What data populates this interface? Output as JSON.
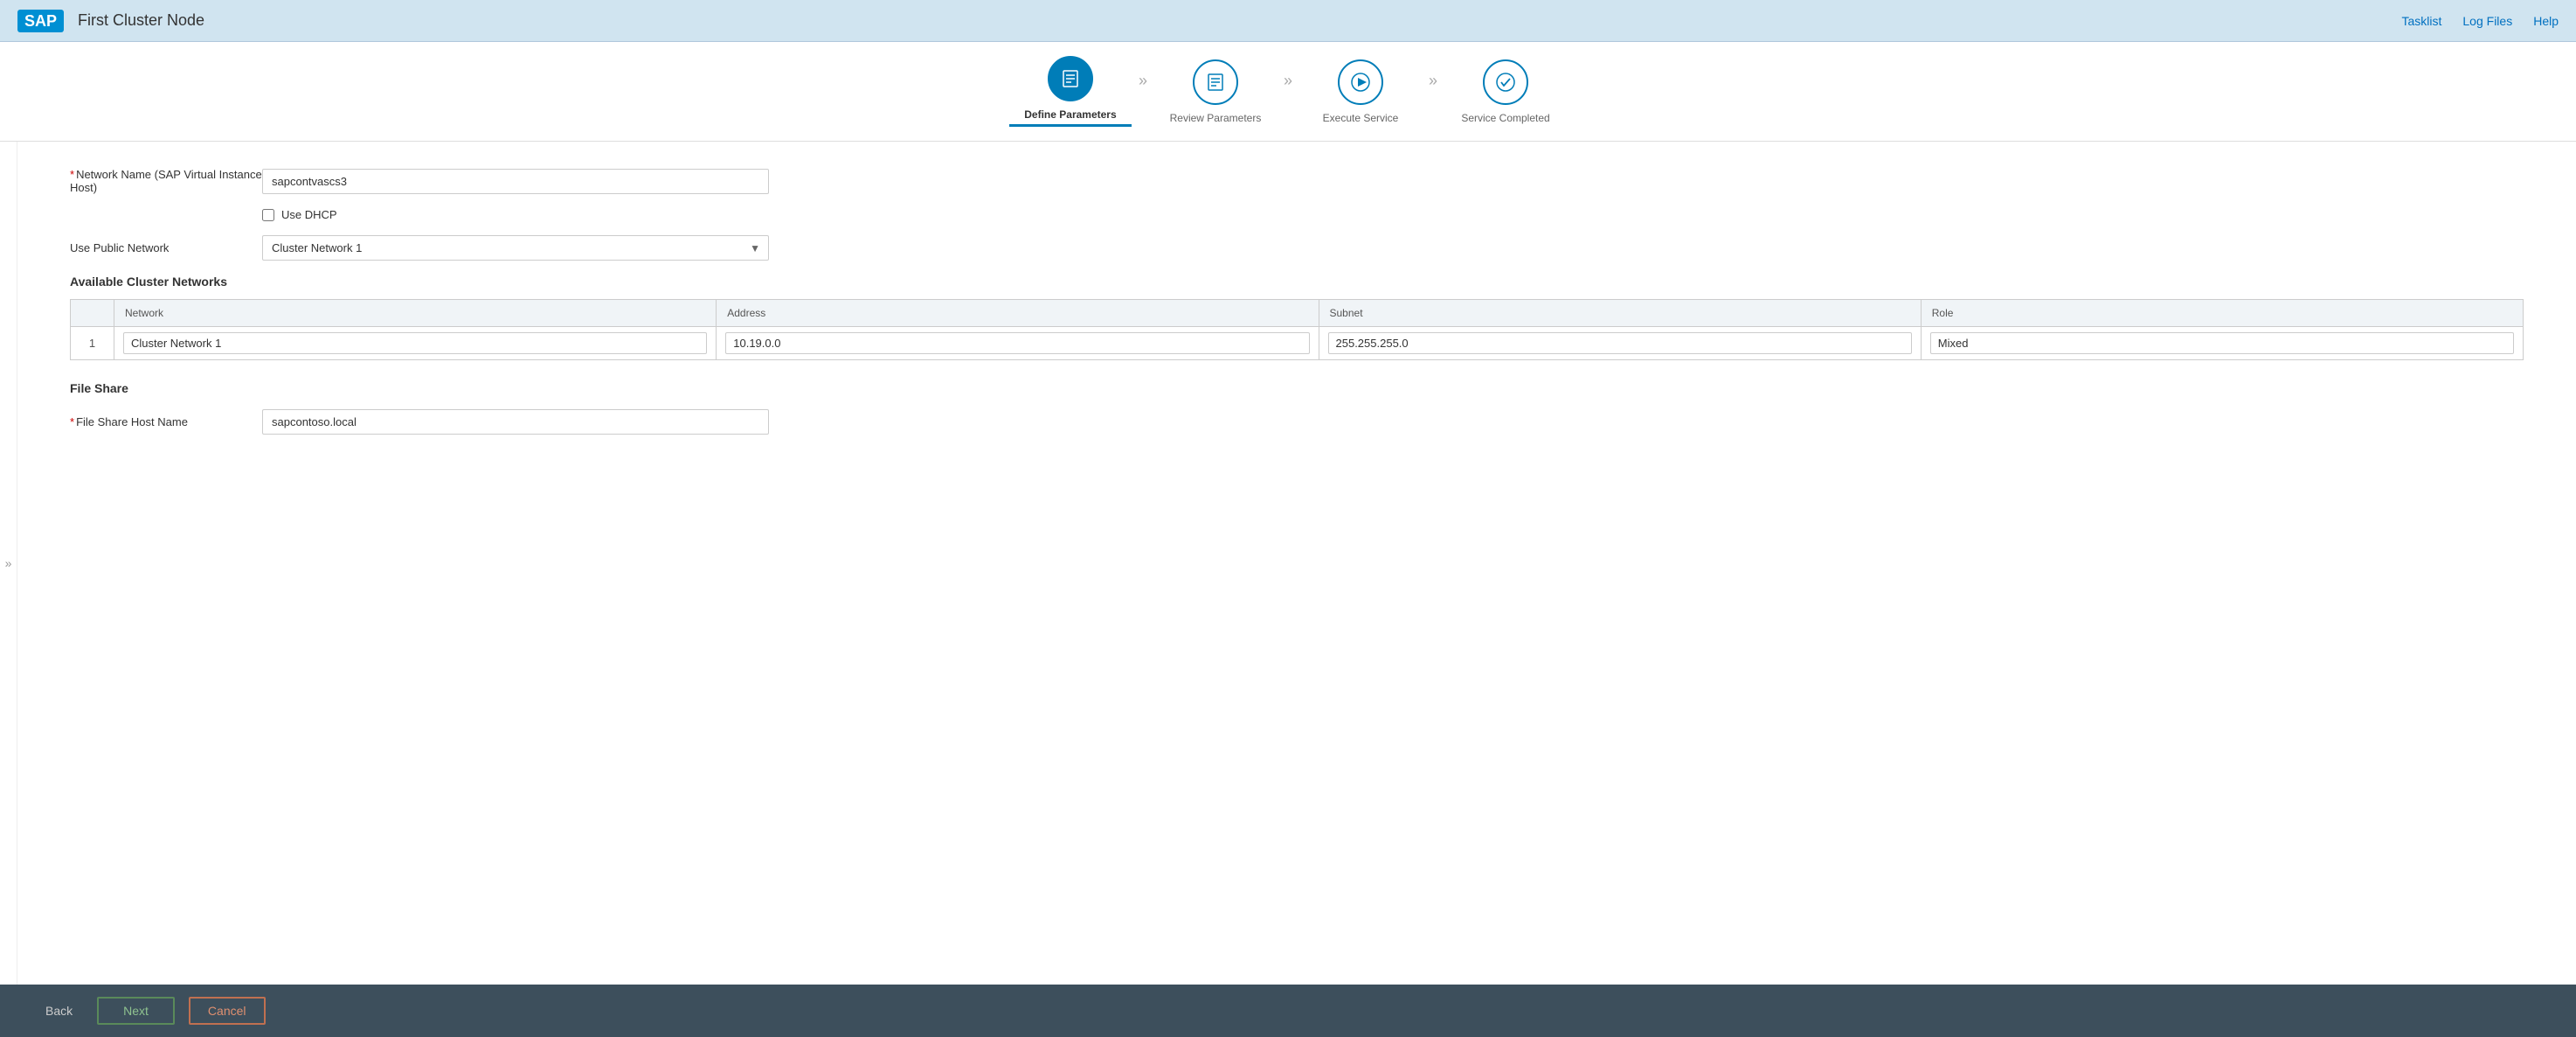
{
  "header": {
    "logo_text": "SAP",
    "title": "First Cluster Node",
    "links": [
      "Tasklist",
      "Log Files",
      "Help"
    ]
  },
  "wizard": {
    "steps": [
      {
        "id": "define",
        "label": "Define Parameters",
        "active": true,
        "icon": "list"
      },
      {
        "id": "review",
        "label": "Review Parameters",
        "active": false,
        "icon": "review"
      },
      {
        "id": "execute",
        "label": "Execute Service",
        "active": false,
        "icon": "play"
      },
      {
        "id": "completed",
        "label": "Service Completed",
        "active": false,
        "icon": "check"
      }
    ]
  },
  "form": {
    "network_name_label": "Network Name (SAP Virtual Instance Host)",
    "network_name_value": "sapcontvascs3",
    "use_dhcp_label": "Use DHCP",
    "use_public_network_label": "Use Public Network",
    "use_public_network_value": "Cluster Network 1",
    "available_cluster_networks_heading": "Available Cluster Networks",
    "table": {
      "columns": [
        "",
        "Network",
        "Address",
        "Subnet",
        "Role"
      ],
      "rows": [
        {
          "num": "1",
          "network": "Cluster Network 1",
          "address": "10.19.0.0",
          "subnet": "255.255.255.0",
          "role": "Mixed"
        }
      ]
    },
    "file_share_heading": "File Share",
    "file_share_host_label": "File Share Host Name",
    "file_share_host_value": "sapcontoso.local"
  },
  "footer": {
    "back_label": "Back",
    "next_label": "Next",
    "cancel_label": "Cancel"
  }
}
